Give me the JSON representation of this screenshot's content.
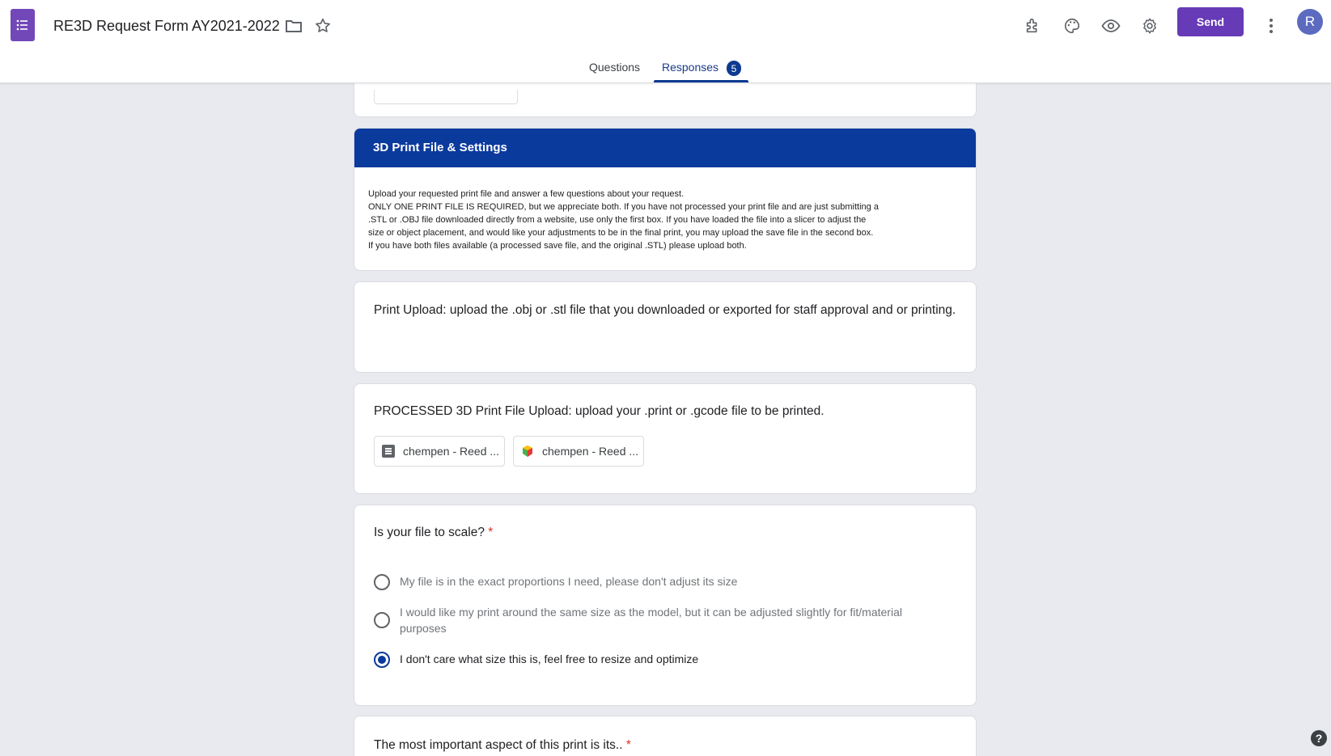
{
  "header": {
    "title": "RE3D Request Form AY2021-2022",
    "send_label": "Send",
    "avatar_initial": "R",
    "icons": [
      "forms-app-icon",
      "folder-icon",
      "star-icon",
      "addon-icon",
      "palette-icon",
      "preview-eye-icon",
      "settings-gear-icon",
      "more-vert-icon"
    ]
  },
  "tabs": {
    "questions": "Questions",
    "responses": "Responses",
    "responses_count": "5"
  },
  "section": {
    "title": "3D Print File & Settings",
    "description": [
      "Upload your requested print file and answer a few questions about your request.",
      "ONLY ONE PRINT FILE IS REQUIRED, but we appreciate both. If you have not processed your print file and are just submitting a",
      ".STL or .OBJ file downloaded directly from a website, use only the first box. If you have loaded the file into a slicer to adjust the",
      "size or object placement, and would like your adjustments to be in the final print, you may upload the save file in the second box.",
      "If you have both files available (a processed save file, and the original .STL) please upload both."
    ]
  },
  "questions": {
    "print_upload": {
      "title": "Print Upload: upload the .obj or .stl file that you downloaded or exported for staff approval and or printing."
    },
    "processed_upload": {
      "title": "PROCESSED 3D Print File Upload: upload your .print or .gcode file to be printed.",
      "files": [
        {
          "name": "chempen - Reed ...",
          "icon": "document-file-icon"
        },
        {
          "name": "chempen - Reed ...",
          "icon": "slicer-file-icon"
        }
      ]
    },
    "scale": {
      "title": "Is your file to scale?",
      "required_mark": "*",
      "options": [
        "My file is in the exact proportions I need, please don't adjust its size",
        "I would like my print around the same size as the model, but it can be adjusted slightly for fit/material purposes",
        "I don't care what size this is, feel free to resize and optimize"
      ],
      "selected_index": 2
    },
    "important": {
      "title": "The most important aspect of this print is its..",
      "required_mark": "*"
    }
  },
  "colors": {
    "brand_purple": "#673ab7",
    "section_blue": "#0b3a9d",
    "background": "#e8eaf0",
    "required_red": "#d93025"
  },
  "help_glyph": "?"
}
